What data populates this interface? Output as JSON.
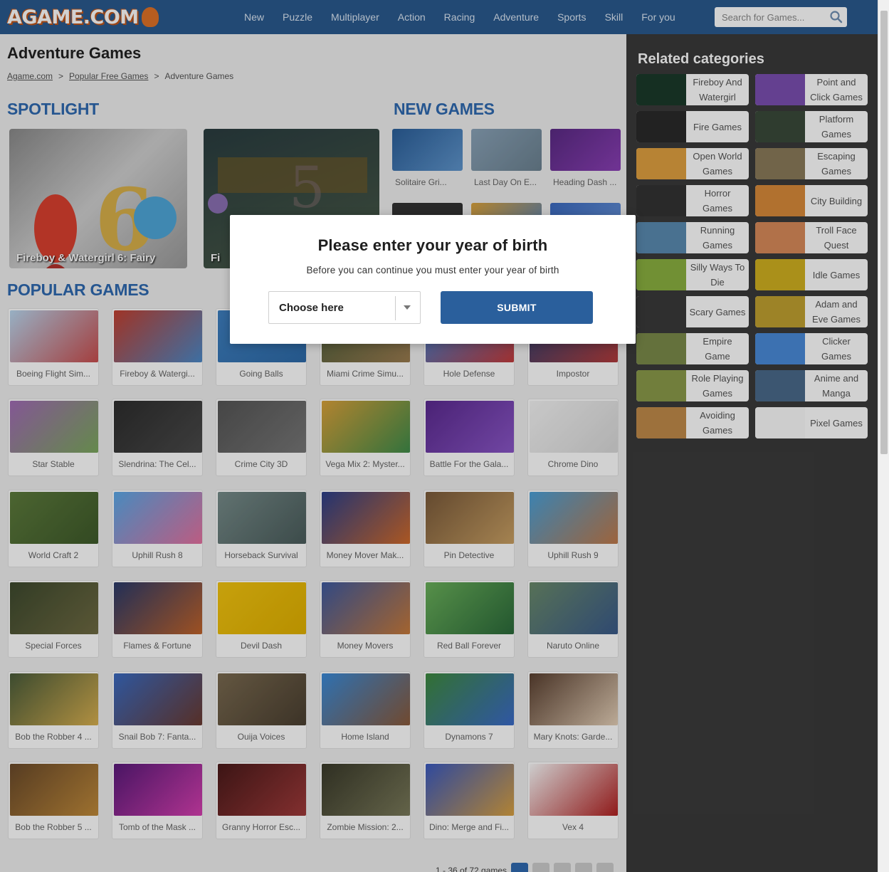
{
  "header": {
    "logo": "AGAME.COM",
    "nav": [
      "New",
      "Puzzle",
      "Multiplayer",
      "Action",
      "Racing",
      "Adventure",
      "Sports",
      "Skill",
      "For you"
    ],
    "search_placeholder": "Search for Games..."
  },
  "page": {
    "title": "Adventure Games",
    "breadcrumb": [
      "Agame.com",
      "Popular Free Games",
      "Adventure Games"
    ],
    "breadcrumb_sep": ">"
  },
  "sections": {
    "spotlight": "SPOTLIGHT",
    "new_games": "NEW GAMES",
    "popular_games": "POPULAR GAMES"
  },
  "spotlight": [
    "Fireboy & Watergirl 6: Fairy",
    "Fi"
  ],
  "new_games": [
    "Solitaire Gri...",
    "Last Day On E...",
    "Heading Dash ..."
  ],
  "popular_games": [
    [
      "Boeing Flight Sim...",
      "Fireboy & Watergi...",
      "Going Balls",
      "Miami Crime Simu...",
      "Hole Defense",
      "Impostor"
    ],
    [
      "Star Stable",
      "Slendrina: The Cel...",
      "Crime City 3D",
      "Vega Mix 2: Myster...",
      "Battle For the Gala...",
      "Chrome Dino"
    ],
    [
      "World Craft 2",
      "Uphill Rush 8",
      "Horseback Survival",
      "Money Mover Mak...",
      "Pin Detective",
      "Uphill Rush 9"
    ],
    [
      "Special Forces",
      "Flames & Fortune",
      "Devil Dash",
      "Money Movers",
      "Red Ball Forever",
      "Naruto Online"
    ],
    [
      "Bob the Robber 4 ...",
      "Snail Bob 7: Fanta...",
      "Ouija Voices",
      "Home Island",
      "Dynamons 7",
      "Mary Knots: Garde..."
    ],
    [
      "Bob the Robber 5 ...",
      "Tomb of the Mask ...",
      "Granny Horror Esc...",
      "Zombie Mission: 2...",
      "Dino: Merge and Fi...",
      "Vex 4"
    ]
  ],
  "pager_text": "1 - 36 of 72 games",
  "sidebar": {
    "title": "Related categories",
    "categories": [
      [
        "Fireboy And Watergirl",
        "Point and Click Games"
      ],
      [
        "Fire Games",
        "Platform Games"
      ],
      [
        "Open World Games",
        "Escaping Games"
      ],
      [
        "Horror Games",
        "City Building"
      ],
      [
        "Running Games",
        "Troll Face Quest"
      ],
      [
        "Silly Ways To Die",
        "Idle Games"
      ],
      [
        "Scary Games",
        "Adam and Eve Games"
      ],
      [
        "Empire Game",
        "Clicker Games"
      ],
      [
        "Role Playing Games",
        "Anime and Manga"
      ],
      [
        "Avoiding Games",
        "Pixel Games"
      ]
    ]
  },
  "modal": {
    "title": "Please enter your year of birth",
    "subtitle": "Before you can continue you must enter your year of birth",
    "select_value": "Choose here",
    "submit_label": "SUBMIT"
  },
  "colors": {
    "header_bg": "#2a5a8e",
    "section_heading": "#2f6ab0",
    "sidebar_bg": "#3a3a3a",
    "submit_bg": "#2a5f9c"
  }
}
